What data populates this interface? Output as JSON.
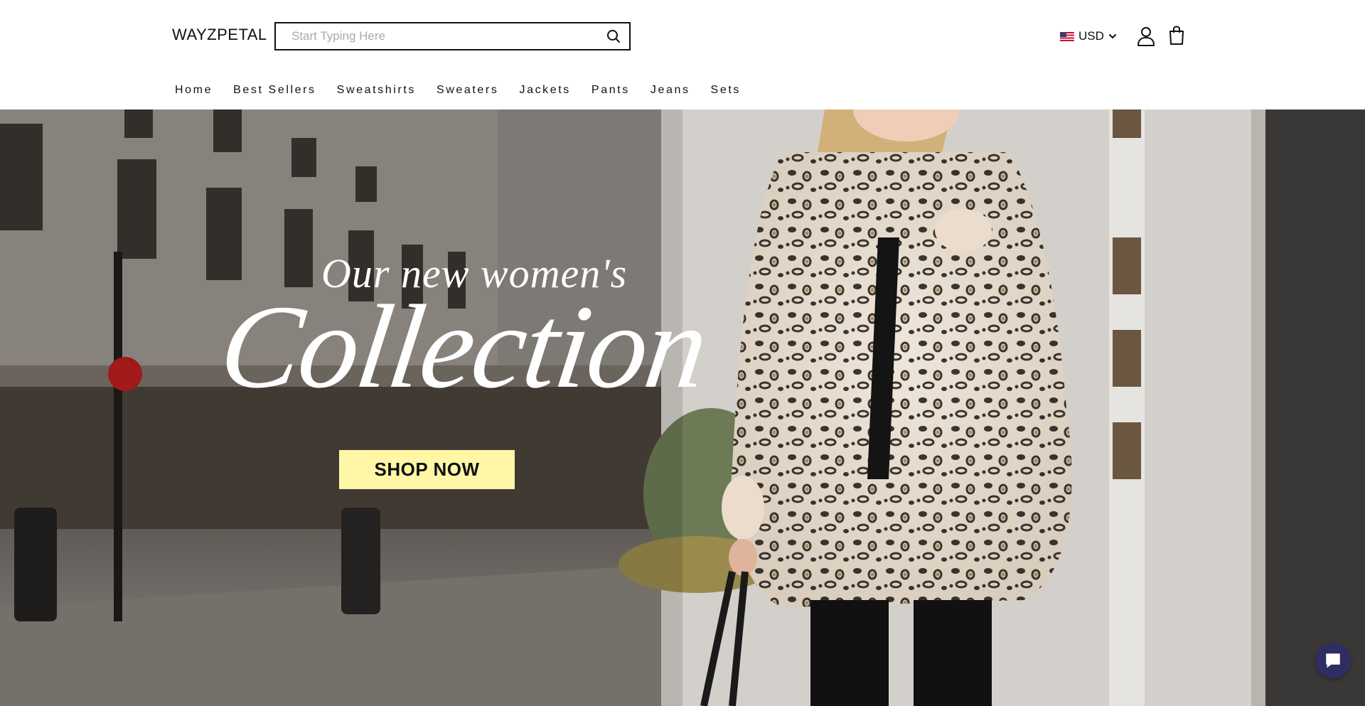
{
  "brand": {
    "logo_text": "WAYZPETAL"
  },
  "search": {
    "placeholder": "Start Typing Here",
    "value": ""
  },
  "currency": {
    "label": "USD",
    "flag_icon": "us-flag-icon"
  },
  "header_icons": {
    "account": "user-icon",
    "cart": "shopping-bag-icon",
    "search": "search-icon"
  },
  "nav": {
    "items": [
      {
        "label": "Home"
      },
      {
        "label": "Best Sellers"
      },
      {
        "label": "Sweatshirts"
      },
      {
        "label": "Sweaters"
      },
      {
        "label": "Jackets"
      },
      {
        "label": "Pants"
      },
      {
        "label": "Jeans"
      },
      {
        "label": "Sets"
      }
    ]
  },
  "hero": {
    "tagline": "Our new women's",
    "headline": "Collection",
    "cta_label": "SHOP NOW",
    "cta_color": "#fff6a6"
  },
  "chat": {
    "icon": "chat-bubble-icon",
    "color": "#2e2e62"
  }
}
